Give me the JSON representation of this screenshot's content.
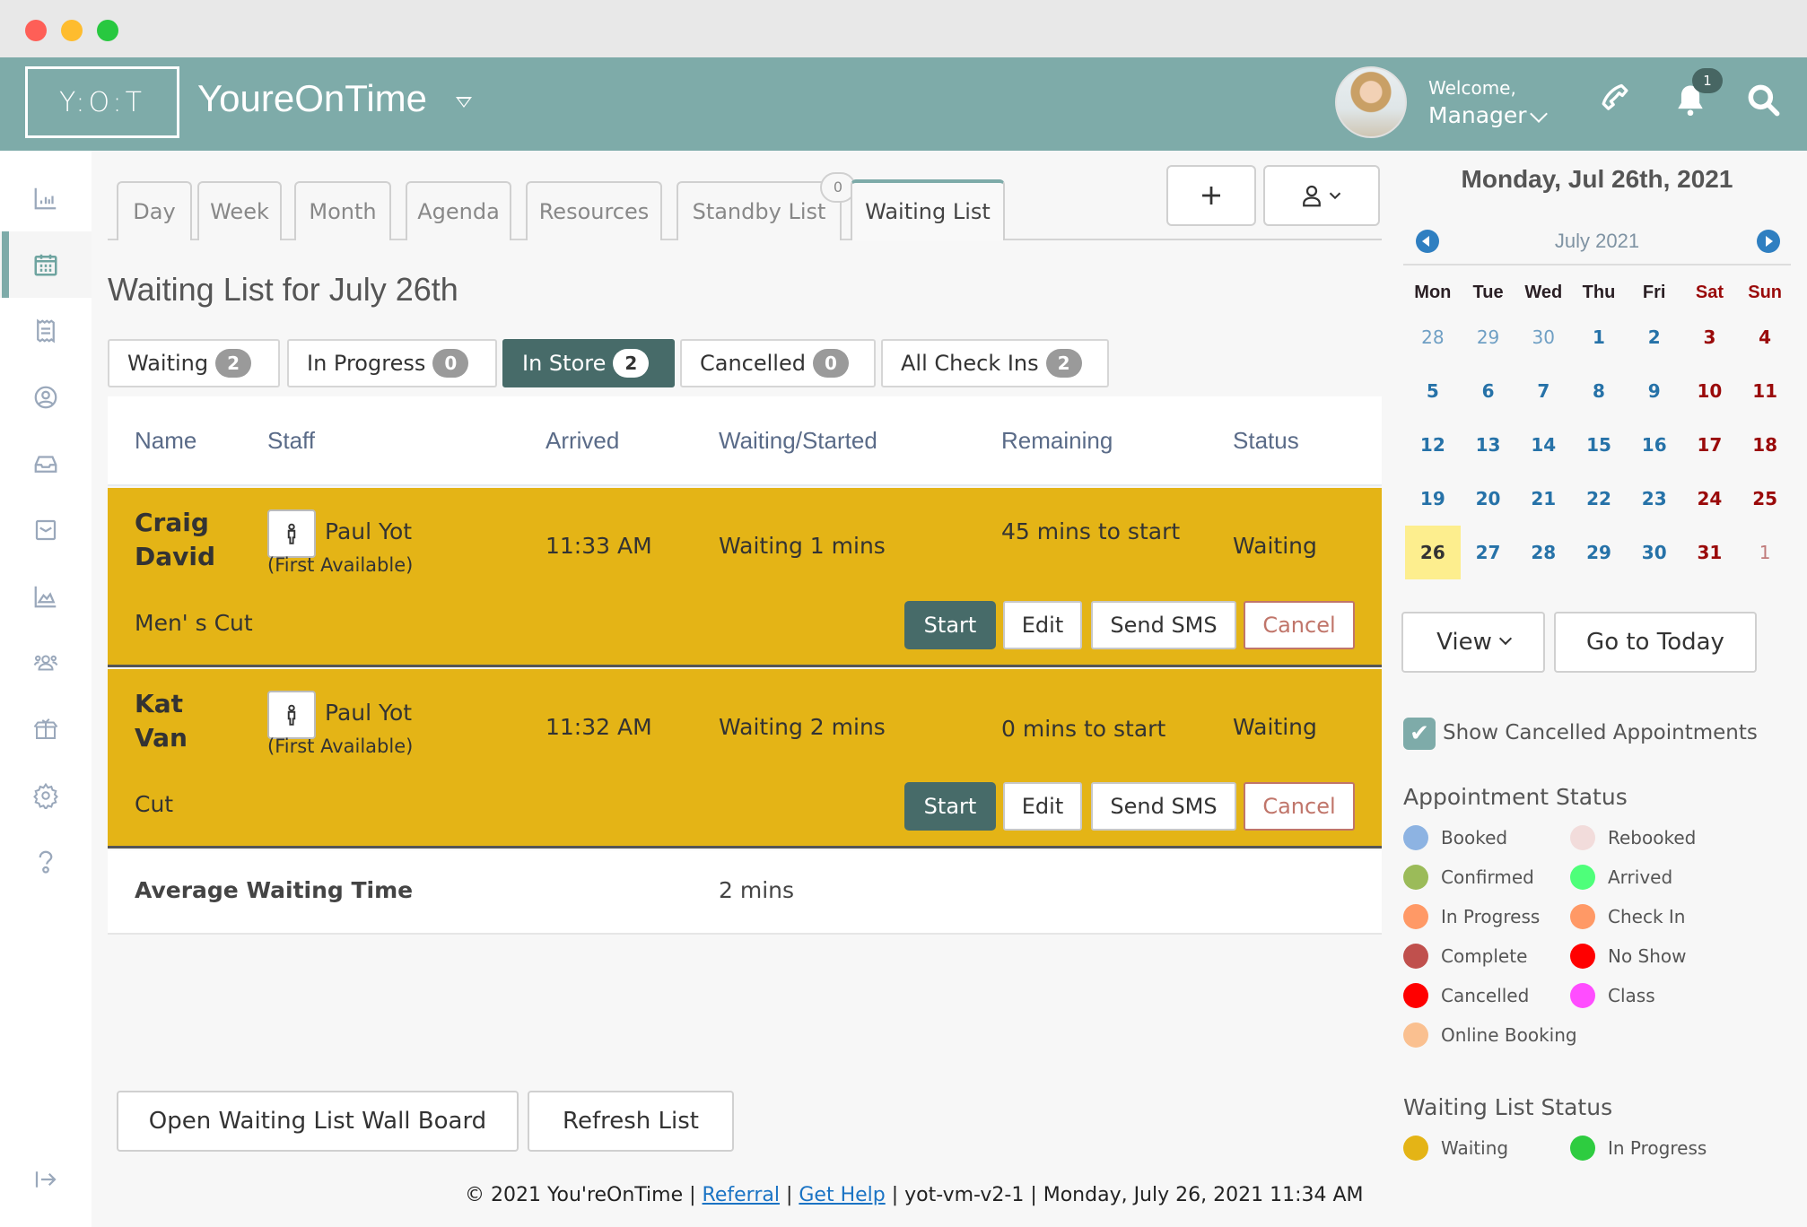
{
  "header": {
    "logo": "Y:O:T",
    "app_title": "YoureOnTime",
    "welcome": "Welcome,",
    "user": "Manager",
    "notification_count": "1"
  },
  "sidebar": {
    "items": [
      {
        "icon": "bar-chart-icon",
        "active": false
      },
      {
        "icon": "calendar-icon",
        "active": true
      },
      {
        "icon": "receipt-icon",
        "active": false
      },
      {
        "icon": "user-circle-icon",
        "active": false
      },
      {
        "icon": "inbox-icon",
        "active": false
      },
      {
        "icon": "envelope-icon",
        "active": false
      },
      {
        "icon": "area-chart-icon",
        "active": false
      },
      {
        "icon": "users-icon",
        "active": false
      },
      {
        "icon": "gift-icon",
        "active": false
      },
      {
        "icon": "gear-icon",
        "active": false
      },
      {
        "icon": "help-icon",
        "active": false
      },
      {
        "icon": "logout-icon",
        "active": false
      }
    ]
  },
  "tabs": [
    {
      "label": "Day"
    },
    {
      "label": "Week"
    },
    {
      "label": "Month"
    },
    {
      "label": "Agenda"
    },
    {
      "label": "Resources"
    },
    {
      "label": "Standby List",
      "badge": "0"
    },
    {
      "label": "Waiting List",
      "active": true
    }
  ],
  "toolbar": {
    "add_label": "+"
  },
  "page_title": "Waiting List for July 26th",
  "filters": [
    {
      "label": "Waiting",
      "count": "2"
    },
    {
      "label": "In Progress",
      "count": "0"
    },
    {
      "label": "In Store",
      "count": "2",
      "active": true
    },
    {
      "label": "Cancelled",
      "count": "0"
    },
    {
      "label": "All Check Ins",
      "count": "2"
    }
  ],
  "table": {
    "headers": {
      "name": "Name",
      "staff": "Staff",
      "arrived": "Arrived",
      "waiting": "Waiting/Started",
      "remaining": "Remaining",
      "status": "Status"
    },
    "rows": [
      {
        "first": "Craig",
        "last": "David",
        "staff": "Paul Yot",
        "staff_note": "(First Available)",
        "arrived": "11:33 AM",
        "waiting": "Waiting 1 mins",
        "remaining": "45 mins to start",
        "status": "Waiting",
        "service": "Men' s Cut"
      },
      {
        "first": "Kat",
        "last": "Van",
        "staff": "Paul Yot",
        "staff_note": "(First Available)",
        "arrived": "11:32 AM",
        "waiting": "Waiting 2 mins",
        "remaining": "0 mins to start",
        "status": "Waiting",
        "service": "Cut"
      }
    ],
    "actions": {
      "start": "Start",
      "edit": "Edit",
      "sms": "Send SMS",
      "cancel": "Cancel"
    },
    "average_label": "Average Waiting Time",
    "average_value": "2 mins"
  },
  "bottom_buttons": {
    "wall_board": "Open Waiting List Wall Board",
    "refresh": "Refresh List"
  },
  "footer": {
    "copyright": "© 2021 You'reOnTime | ",
    "referral": "Referral",
    "sep": " | ",
    "help": "Get Help",
    "tail": " | yot-vm-v2-1 | Monday, July 26, 2021  11:34 AM"
  },
  "calendar": {
    "selected_date": "Monday, Jul 26th, 2021",
    "month": "July 2021",
    "dow": [
      "Mon",
      "Tue",
      "Wed",
      "Thu",
      "Fri",
      "Sat",
      "Sun"
    ],
    "weeks": [
      [
        "28",
        "29",
        "30",
        "1",
        "2",
        "3",
        "4"
      ],
      [
        "5",
        "6",
        "7",
        "8",
        "9",
        "10",
        "11"
      ],
      [
        "12",
        "13",
        "14",
        "15",
        "16",
        "17",
        "18"
      ],
      [
        "19",
        "20",
        "21",
        "22",
        "23",
        "24",
        "25"
      ],
      [
        "26",
        "27",
        "28",
        "29",
        "30",
        "31",
        "1"
      ]
    ],
    "today": "26",
    "view_label": "View",
    "today_label": "Go to Today"
  },
  "options": {
    "show_cancelled_label": "Show Cancelled Appointments",
    "show_cancelled_checked": true
  },
  "appointment_status": {
    "title": "Appointment Status",
    "items": [
      {
        "label": "Booked",
        "color": "#8db3e2"
      },
      {
        "label": "Rebooked",
        "color": "#f2dcdb"
      },
      {
        "label": "Confirmed",
        "color": "#9bbb59"
      },
      {
        "label": "Arrived",
        "color": "#4eff7a"
      },
      {
        "label": "In Progress",
        "color": "#ff9966"
      },
      {
        "label": "Check In",
        "color": "#ff9966"
      },
      {
        "label": "Complete",
        "color": "#c0504d"
      },
      {
        "label": "No Show",
        "color": "#ff0000"
      },
      {
        "label": "Cancelled",
        "color": "#ff0000"
      },
      {
        "label": "Class",
        "color": "#ff4dff"
      },
      {
        "label": "Online Booking",
        "color": "#fac090"
      }
    ]
  },
  "waiting_list_status": {
    "title": "Waiting List Status",
    "items": [
      {
        "label": "Waiting",
        "color": "#e4b416"
      },
      {
        "label": "In Progress",
        "color": "#2ecc40"
      }
    ]
  }
}
